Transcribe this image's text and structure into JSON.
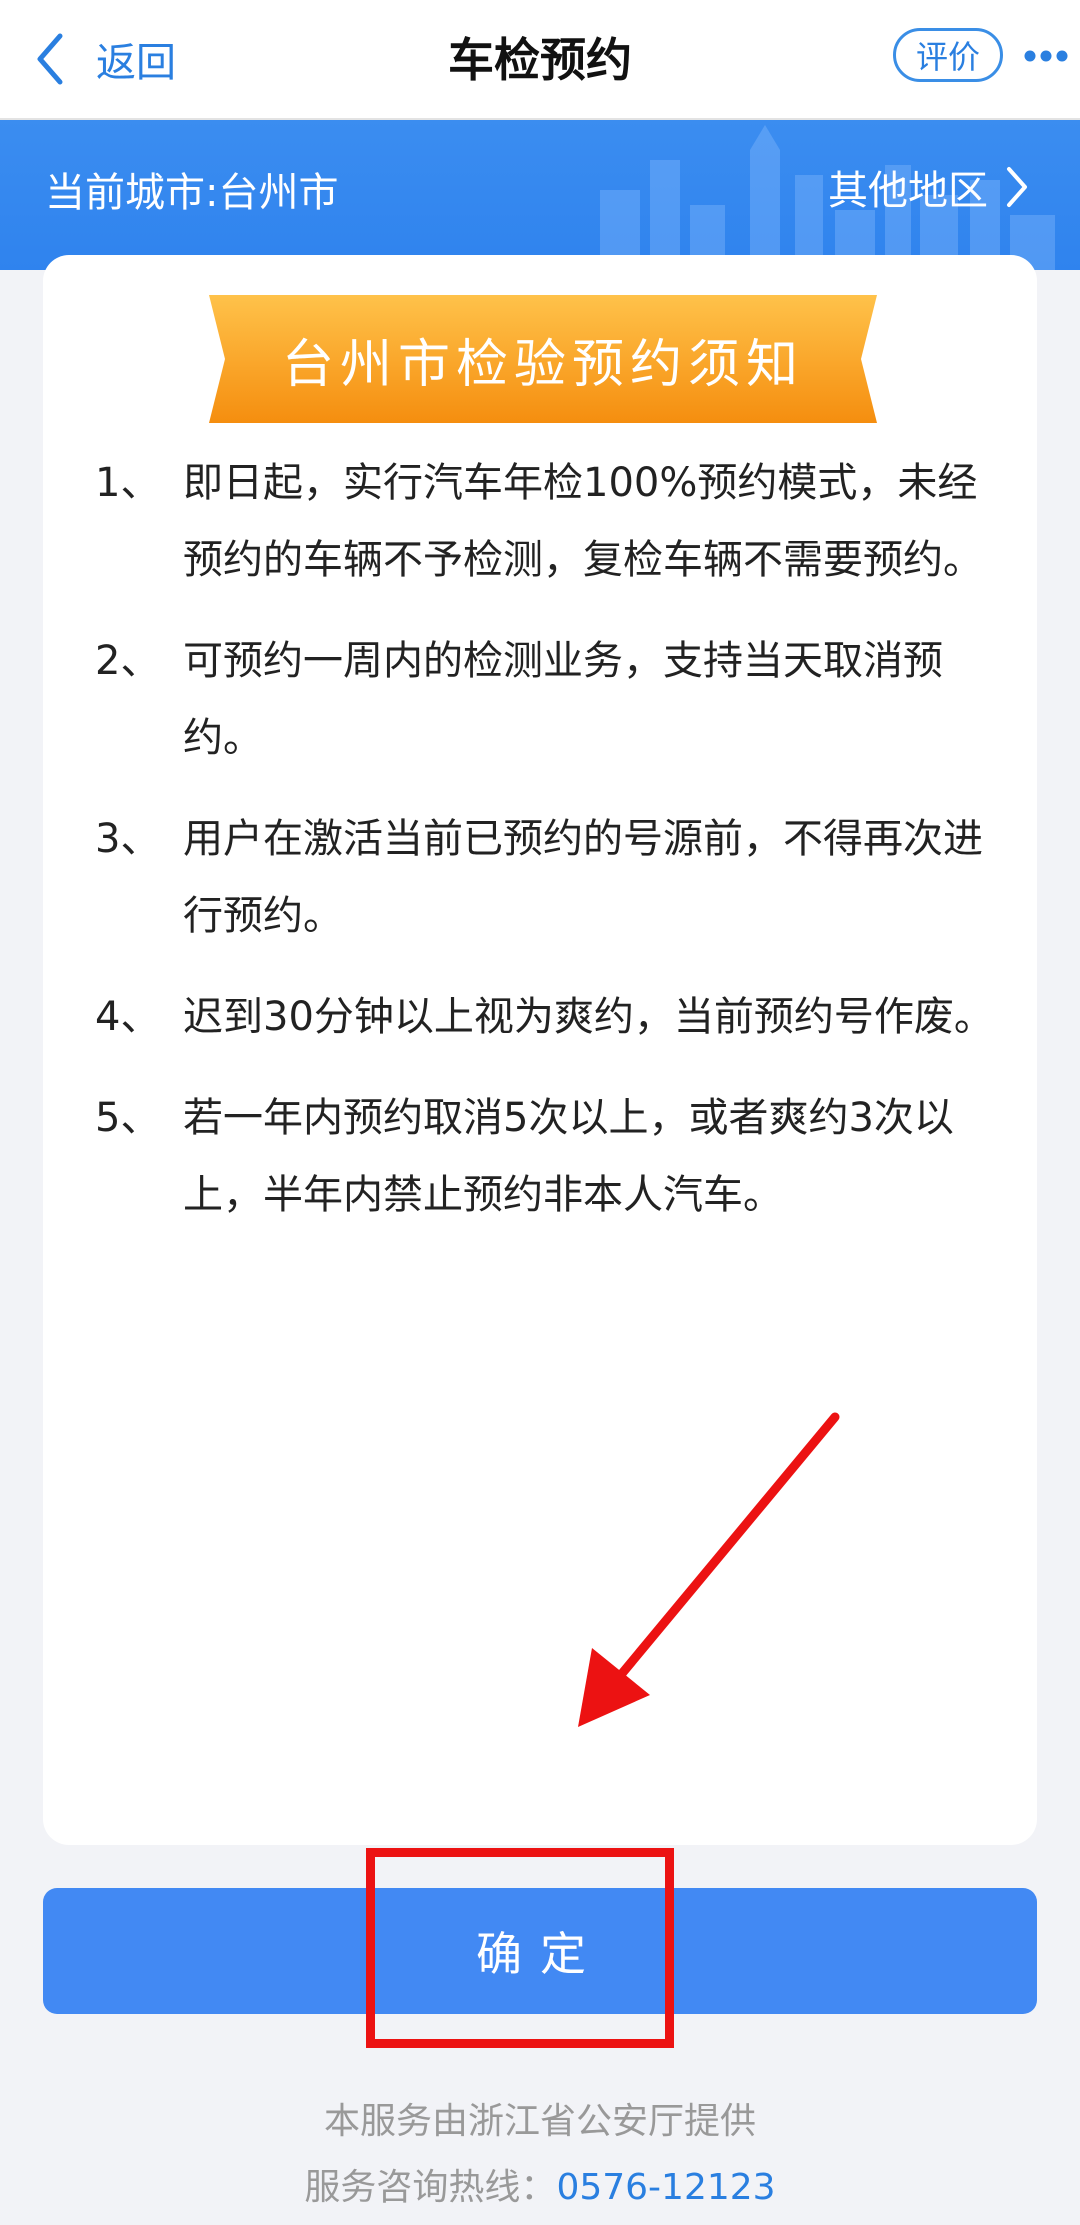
{
  "nav": {
    "back_label": "返回",
    "title": "车检预约",
    "rate_label": "评价",
    "more_icon": "more-dots-icon"
  },
  "banner": {
    "city_label": "当前城市:台州市",
    "other_region_label": "其他地区"
  },
  "notice": {
    "title": "台州市检验预约须知",
    "items": [
      {
        "num": "1、",
        "text": "即日起，实行汽车年检100%预约模式，未经预约的车辆不予检测，复检车辆不需要预约。"
      },
      {
        "num": "2、",
        "text": "可预约一周内的检测业务，支持当天取消预约。"
      },
      {
        "num": "3、",
        "text": "用户在激活当前已预约的号源前，不得再次进行预约。"
      },
      {
        "num": "4、",
        "text": "迟到30分钟以上视为爽约，当前预约号作废。"
      },
      {
        "num": "5、",
        "text": "若一年内预约取消5次以上，或者爽约3次以上，半年内禁止预约非本人汽车。"
      }
    ]
  },
  "confirm_label": "确定",
  "footer": {
    "provider": "本服务由浙江省公安厅提供",
    "hotline_label": "服务咨询热线：",
    "hotline_number": "0576-12123"
  },
  "colors": {
    "accent": "#4289f3",
    "ribbon": "#f7a21f",
    "annotation": "#ec1212"
  }
}
